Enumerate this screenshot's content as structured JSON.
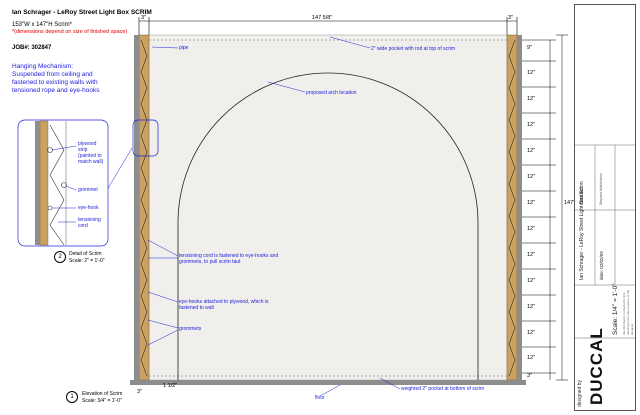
{
  "header": {
    "title": "Ian Schrager - LeRoy Street Light Box SCRIM",
    "size": "153\"W x 147\"H Scrim*",
    "note": "*(dimensions depend on size of finished space)",
    "job": "JOB#: 302847",
    "hanging": "Hanging Mechanism: Suspended from ceiling and fastened to existing walls with tensioned rope and eye-hooks"
  },
  "dimensions": {
    "top_left": "3\"",
    "top_width": "147 5/8\"",
    "top_right": "3\"",
    "right_spacing": [
      "9\"",
      "12\"",
      "12\"",
      "12\"",
      "12\"",
      "12\"",
      "12\"",
      "12\"",
      "12\"",
      "12\"",
      "12\"",
      "12\"",
      "12\""
    ],
    "bottom_right": "3\"",
    "overall_height": "147\"",
    "bottom_left": "3\"",
    "bottom_offset": "1 1/2\""
  },
  "labels": {
    "pipe": "pipe",
    "pocket_top": "2\" wide pocket with rod at top of scrim",
    "arch": "proposed arch location",
    "tensioning": "tensioning cord is fastened to eye-hooks and grommets, to pull scrim taut",
    "eyehooks": "eye-hooks attached to plywood, which is fastened to wall",
    "grommets": "grommets",
    "pocket_bottom": "weighted 2\" pocket at bottom of scrim",
    "floor": "floor"
  },
  "detail": {
    "plywood": "plywood strip (painted to match wall)",
    "grommet": "grommet",
    "eyehook": "eye-hook",
    "cord": "tensioning cord"
  },
  "captions": {
    "detail_num": "2",
    "detail_title": "Detail of Scrim",
    "detail_scale": "Scale: 2\" = 1'-0\"",
    "elev_num": "1",
    "elev_title": "Elevation of Scrim",
    "elev_scale": "Scale: 3/4\" = 1'-0\""
  },
  "title_block": {
    "designed_by": "designed by",
    "logo": "DUCCAL",
    "scale": "Scale: 1/4\" = 1'-0\"",
    "project": "Ian Schrager - LeRoy Street Light Box Scrim",
    "date": "date: 02/02/09",
    "contact": "contact:",
    "contact_info": "Stephen Hutchinson",
    "disclaimer": "the information contained in this drawing is the sole property of the designer"
  },
  "colors": {
    "annotation": "#2222dd",
    "note_red": "#e00000",
    "plywood": "#c9a163"
  }
}
